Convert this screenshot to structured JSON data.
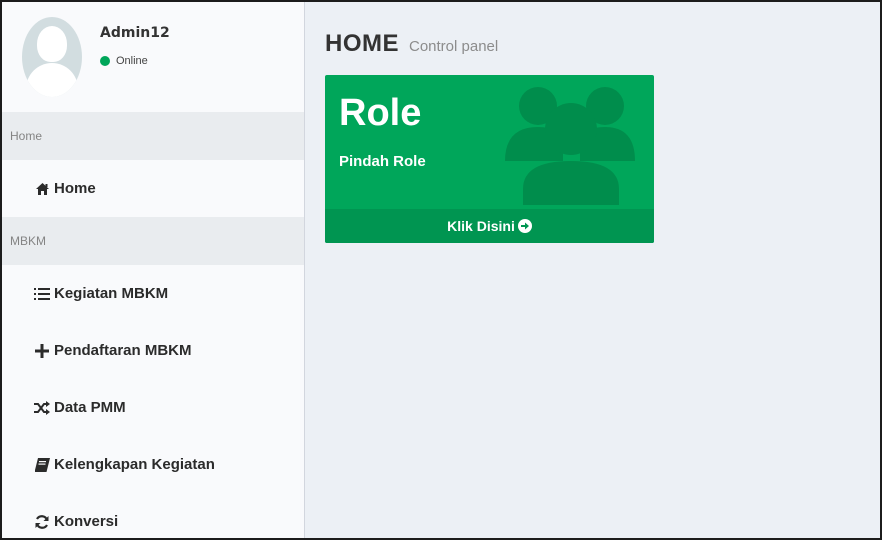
{
  "user": {
    "name": "Admin12",
    "status": "Online",
    "status_color": "#00a65a"
  },
  "sidebar": {
    "sections": [
      {
        "header": "Home"
      },
      {
        "header": "MBKM"
      }
    ],
    "items": [
      {
        "label": "Home",
        "icon": "home-icon"
      },
      {
        "label": "Kegiatan MBKM",
        "icon": "list-icon"
      },
      {
        "label": "Pendaftaran MBKM",
        "icon": "plus-icon"
      },
      {
        "label": "Data PMM",
        "icon": "random-icon"
      },
      {
        "label": "Kelengkapan Kegiatan",
        "icon": "book-icon"
      },
      {
        "label": "Konversi",
        "icon": "refresh-icon"
      }
    ]
  },
  "header": {
    "title": "HOME",
    "subtitle": "Control panel"
  },
  "role_box": {
    "title": "Role",
    "subtitle": "Pindah Role",
    "footer_label": "Klik Disini",
    "icon": "users-icon",
    "color": "#00a65a"
  }
}
